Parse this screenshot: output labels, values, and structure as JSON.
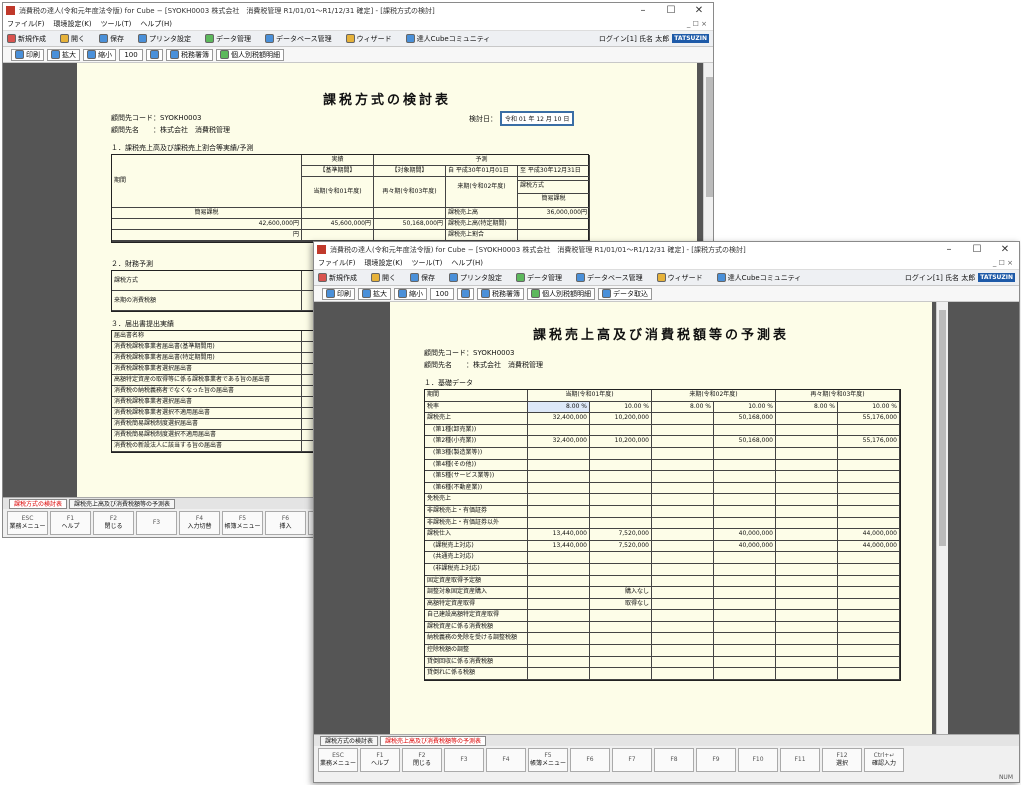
{
  "win1": {
    "title": "消費税の達人(令和元年度法令版) for Cube − [SYOKH0003 株式会社　消費税管理 R1/01/01〜R1/12/31 確定] - [課税方式の検討]",
    "menu": [
      "ファイル(F)",
      "環境設定(K)",
      "ツール(T)",
      "ヘルプ(H)"
    ],
    "menu_right": "_ ☐ ×",
    "toolbar": [
      "新規作成",
      "開く",
      "保存",
      "プリンタ設定",
      "データ管理",
      "データベース管理",
      "ウィザード",
      "達人Cubeコミュニティ"
    ],
    "login": "ログイン[1] 氏名 太郎",
    "logo": "TATSUZIN",
    "viewbar": {
      "print": "印刷",
      "zoom_in": "拡大",
      "zoom_out": "縮小",
      "zoom": "100 %",
      "b1": "税務署簿",
      "b2": "個人別税額明細"
    },
    "doc": {
      "title": "課税方式の検討表",
      "code_label": "顧問先コード：SYOKH0003",
      "name_label": "顧問先名　　：株式会社　消費税管理",
      "date_label": "検討日：",
      "date_value": "令和 01 年 12 月 10 日",
      "sec1": "１．課税売上高及び課税売上割合等実績/予測",
      "t1": {
        "h_term": "期間",
        "h_actual": "実績",
        "h_forecast": "予測",
        "h_base": "【基準期間】",
        "h_from": "自 平成30年01月01日",
        "h_to": "至 平成30年12月31日",
        "h_cur": "当期(令和01年度)",
        "h_target": "【対象期間】",
        "h_next": "来期(令和02年度)",
        "h_next2": "再々期(令和03年度)",
        "rows": [
          {
            "label": "課税方式",
            "a": "簡易課税",
            "b": "簡易課税",
            "c": "",
            "d": ""
          },
          {
            "label": "課税売上高",
            "a": "36,000,000円",
            "b": "42,600,000円",
            "c": "45,600,000円",
            "d": "50,168,000円"
          },
          {
            "label": "課税売上高(特定期間)",
            "a": "",
            "b": "円",
            "c": "",
            "d": ""
          },
          {
            "label": "課税売上割合",
            "a": "",
            "b": "",
            "c": "",
            "d": ""
          }
        ]
      },
      "sec2": "２．財務予測",
      "t2": [
        "課税方式",
        "来期の消費税額"
      ],
      "sec3": "３．届出書提出実績",
      "t3": [
        "届出書名称",
        "消費税課税事業者届出書(基準期間用)",
        "消費税課税事業者届出書(特定期間用)",
        "消費税課税事業者選択届出書",
        "高額特定資産の取得等に係る課税事業者である旨の届出書",
        "消費税の納税義務者でなくなった旨の届出書",
        "消費税課税事業者選択届出書",
        "消費税課税事業者選択不適用届出書",
        "消費税簡易課税制度選択届出書",
        "消費税簡易課税制度選択不適用届出書",
        "消費税の新設法人に該当する旨の届出書"
      ]
    },
    "sheettabs": [
      "課税方式の検討表",
      "課税売上高及び消費税額等の予測表"
    ],
    "fkeys": [
      {
        "k": "ESC",
        "l": "業務メニュー"
      },
      {
        "k": "F1",
        "l": "ヘルプ"
      },
      {
        "k": "F2",
        "l": "閉じる"
      },
      {
        "k": "F3",
        "l": ""
      },
      {
        "k": "F4",
        "l": "入力切替"
      },
      {
        "k": "F5",
        "l": "帳簿メニュー"
      },
      {
        "k": "F6",
        "l": "挿入"
      },
      {
        "k": "F7",
        "l": "削除"
      }
    ]
  },
  "win2": {
    "title": "消費税の達人(令和元年度法令版) for Cube − [SYOKH0003 株式会社　消費税管理 R1/01/01〜R1/12/31 確定] - [課税方式の検討]",
    "menu": [
      "ファイル(F)",
      "環境設定(K)",
      "ツール(T)",
      "ヘルプ(H)"
    ],
    "menu_right": "_ ☐ ×",
    "toolbar": [
      "新規作成",
      "開く",
      "保存",
      "プリンタ設定",
      "データ管理",
      "データベース管理",
      "ウィザード",
      "達人Cubeコミュニティ"
    ],
    "login": "ログイン[1] 氏名 太郎",
    "logo": "TATSUZIN",
    "viewbar": {
      "print": "印刷",
      "zoom_in": "拡大",
      "zoom_out": "縮小",
      "zoom": "100 %",
      "b1": "税務署簿",
      "b2": "個人別税額明細",
      "b3": "データ取込"
    },
    "doc": {
      "title": "課税売上高及び消費税額等の予測表",
      "code_label": "顧問先コード：SYOKH0003",
      "name_label": "顧問先名　　：株式会社　消費税管理",
      "sec1": "１．基礎データ",
      "cols": [
        "期間",
        "当期(令和01年度)",
        "来期(令和02年度)",
        "再々期(令和03年度)"
      ],
      "rate_row": [
        "税率",
        "8.00 %",
        "10.00 %",
        "8.00 %",
        "10.00 %",
        "8.00 %",
        "10.00 %"
      ],
      "rows": [
        [
          "課税売上",
          "32,400,000",
          "10,200,000",
          "",
          "50,168,000",
          "",
          "55,176,000"
        ],
        [
          "　(第1種(卸売業))",
          "",
          "",
          "",
          "",
          "",
          ""
        ],
        [
          "　(第2種(小売業))",
          "32,400,000",
          "10,200,000",
          "",
          "50,168,000",
          "",
          "55,176,000"
        ],
        [
          "　(第3種(製造業等))",
          "",
          "",
          "",
          "",
          "",
          ""
        ],
        [
          "　(第4種(その他))",
          "",
          "",
          "",
          "",
          "",
          ""
        ],
        [
          "　(第5種(サービス業等))",
          "",
          "",
          "",
          "",
          "",
          ""
        ],
        [
          "　(第6種(不動産業))",
          "",
          "",
          "",
          "",
          "",
          ""
        ],
        [
          "免税売上",
          "",
          "",
          "",
          "",
          "",
          ""
        ],
        [
          "非課税売上・有価証券",
          "",
          "",
          "",
          "",
          "",
          ""
        ],
        [
          "非課税売上・有価証券以外",
          "",
          "",
          "",
          "",
          "",
          ""
        ],
        [
          "課税仕入",
          "13,440,000",
          "7,520,000",
          "",
          "40,000,000",
          "",
          "44,000,000"
        ],
        [
          "　(課税売上対応)",
          "13,440,000",
          "7,520,000",
          "",
          "40,000,000",
          "",
          "44,000,000"
        ],
        [
          "　(共通売上対応)",
          "",
          "",
          "",
          "",
          "",
          ""
        ],
        [
          "　(非課税売上対応)",
          "",
          "",
          "",
          "",
          "",
          ""
        ],
        [
          "固定資産取得予定額",
          "",
          "",
          "",
          "",
          "",
          ""
        ],
        [
          "調整対象固定資産購入",
          "",
          "購入なし",
          "",
          "",
          "",
          ""
        ],
        [
          "高額特定資産取得",
          "",
          "取得なし",
          "",
          "",
          "",
          ""
        ],
        [
          "自己建設高額特定資産取得",
          "",
          "",
          "",
          "",
          "",
          ""
        ],
        [
          "課税資産に係る消費税額",
          "",
          "",
          "",
          "",
          "",
          ""
        ],
        [
          "納税義務の免除を受ける調整税額",
          "",
          "",
          "",
          "",
          "",
          ""
        ],
        [
          "控除税額の調整",
          "",
          "",
          "",
          "",
          "",
          ""
        ],
        [
          "貸倒回収に係る消費税額",
          "",
          "",
          "",
          "",
          "",
          ""
        ],
        [
          "貸倒れに係る税額",
          "",
          "",
          "",
          "",
          "",
          ""
        ]
      ]
    },
    "sheettabs": [
      "課税方式の検討表",
      "課税売上高及び消費税額等の予測表"
    ],
    "fkeys": [
      {
        "k": "ESC",
        "l": "業務メニュー"
      },
      {
        "k": "F1",
        "l": "ヘルプ"
      },
      {
        "k": "F2",
        "l": "閉じる"
      },
      {
        "k": "F3",
        "l": ""
      },
      {
        "k": "F4",
        "l": ""
      },
      {
        "k": "F5",
        "l": "帳簿メニュー"
      },
      {
        "k": "F6",
        "l": ""
      },
      {
        "k": "F7",
        "l": ""
      },
      {
        "k": "F8",
        "l": ""
      },
      {
        "k": "F9",
        "l": ""
      },
      {
        "k": "F10",
        "l": ""
      },
      {
        "k": "F11",
        "l": ""
      },
      {
        "k": "F12",
        "l": "選択"
      },
      {
        "k": "Ctrl+↵",
        "l": "確認入力"
      }
    ],
    "status": "NUM"
  }
}
